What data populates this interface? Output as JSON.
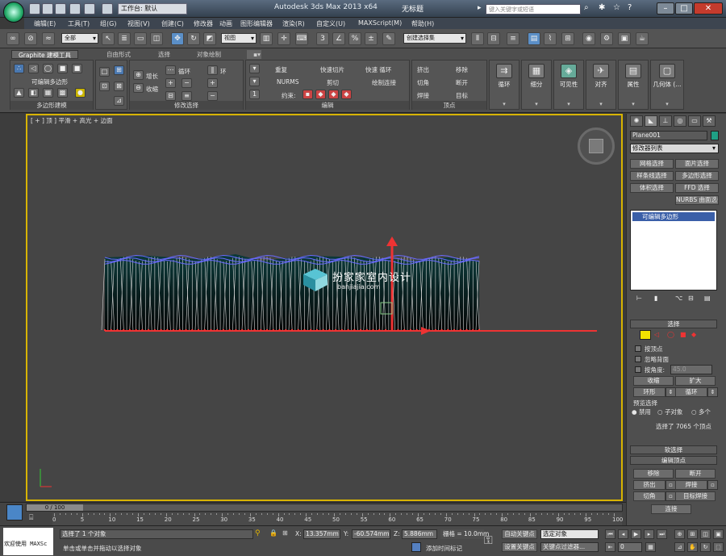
{
  "titlebar": {
    "workspace": "工作台: 默认",
    "app_title": "Autodesk 3ds Max  2013 x64",
    "doc_title": "无标题",
    "search_placeholder": "键入关键字或短语"
  },
  "menu": [
    "编辑(E)",
    "工具(T)",
    "组(G)",
    "视图(V)",
    "创建(C)",
    "修改器",
    "动画",
    "图形编辑器",
    "渲染(R)",
    "自定义(U)",
    "MAXScript(M)",
    "帮助(H)"
  ],
  "maintoolbar": {
    "filter": "全部",
    "coord": "视图",
    "selset": "创建选择集",
    "nums": [
      "3",
      "%"
    ]
  },
  "ribbon": {
    "tabs": [
      "Graphite 建模工具",
      "自由形式",
      "选择",
      "对象绘制"
    ],
    "poly_label": "可编辑多边形",
    "panel_titles": {
      "poly": "多边形建模",
      "modsel": "修改选择",
      "edit": "编辑",
      "vertex": "顶点"
    },
    "modsel": {
      "grow": "增长",
      "shrink": "收缩",
      "loop": "循环",
      "ring": "环"
    },
    "edit": {
      "repeat": "重复",
      "quickslice": "快速切片",
      "quickloop": "快速 循环",
      "nurms": "NURMS",
      "cut": "剪切",
      "paintconnect": "绘制连接",
      "constrain": "约束:"
    },
    "vertex": {
      "extrude": "挤出",
      "chamfer": "切角",
      "weld": "焊接",
      "remove": "移除",
      "break": "断开",
      "target": "目标"
    },
    "big": [
      "循环",
      "细分",
      "可见性",
      "对齐",
      "属性",
      "几何体 (..."
    ]
  },
  "viewport": {
    "label": "[ + ] 顶 ] 平滑 + 高光 + 边面",
    "wm_text": "扮家家室内设计",
    "wm_url": "banjiajia.com"
  },
  "cmdpanel": {
    "obj_name": "Plane001",
    "modlist": "修改器列表",
    "btns": [
      "网格选择",
      "面片选择",
      "样条线选择",
      "多边形选择",
      "体积选择",
      "FFD 选择",
      "NURBS 曲面选择"
    ],
    "stack_item": "可编辑多边形",
    "sel_title": "选择",
    "by_vertex": "按顶点",
    "ignore_back": "忽略背面",
    "angle_label": "按角度:",
    "angle_val": "45.0",
    "shrink": "收缩",
    "grow": "扩大",
    "ring": "环形",
    "loop": "循环",
    "preview": "预览选择",
    "preview_opts": [
      "禁用",
      "子对象",
      "多个"
    ],
    "selected": "选择了 7065 个顶点",
    "soft_sel": "软选择",
    "edit_vert": "编辑顶点",
    "remove": "移除",
    "break": "断开",
    "extrude": "挤出",
    "weld": "焊接",
    "chamfer": "切角",
    "target_weld": "目标焊接",
    "connect": "连接"
  },
  "timeline": {
    "frame": "0 / 100",
    "ticks": [
      "0",
      "5",
      "10",
      "15",
      "20",
      "25",
      "30",
      "35",
      "40",
      "45",
      "50",
      "55",
      "60",
      "65",
      "70",
      "75",
      "80",
      "85",
      "90",
      "95",
      "100"
    ]
  },
  "status": {
    "welcome": "欢迎使用 MAXSc",
    "line1": "选择了 1 个对象",
    "line2": "单击或单击并拖动以选择对象",
    "x": "13.357mm",
    "y": "-60.574mm",
    "z": "5.886mm",
    "grid": "栅格 = 10.0mm",
    "autokey": "自动关键点",
    "setkey": "设置关键点",
    "selobj": "选定对象",
    "filter": "关键点过滤器...",
    "addtime": "添加时间标记",
    "frame": "0"
  }
}
